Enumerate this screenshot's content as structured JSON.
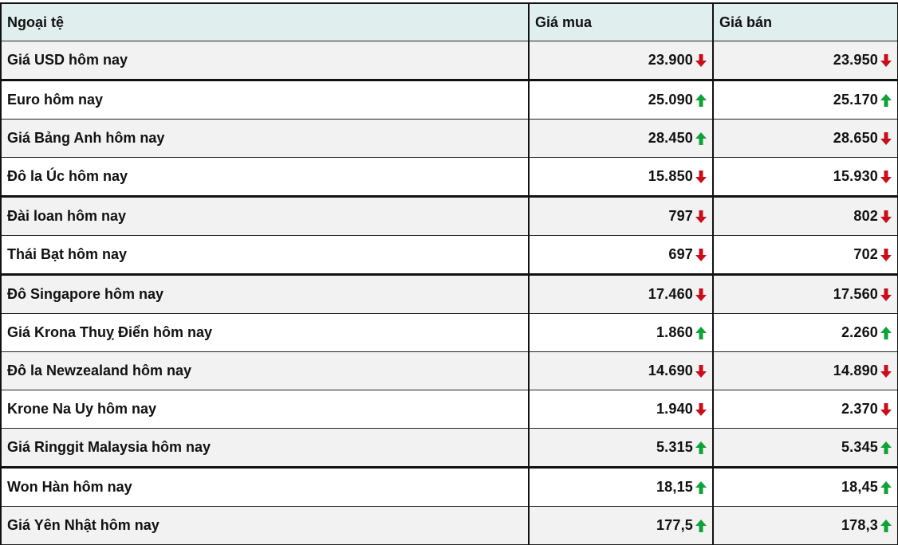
{
  "table": {
    "headers": [
      "Ngoại tệ",
      "Giá mua",
      "Giá bán"
    ],
    "colors": {
      "up": "#12a03a",
      "down": "#c4101c",
      "header_bg": "#e0efee",
      "row_shade": "#f2f2f2"
    },
    "rows": [
      {
        "name": "Giá USD hôm nay",
        "buy": "23.900",
        "buy_trend": "down",
        "sell": "23.950",
        "sell_trend": "down"
      },
      {
        "name": "Euro hôm nay",
        "buy": "25.090",
        "buy_trend": "up",
        "sell": "25.170",
        "sell_trend": "up"
      },
      {
        "name": "Giá Bảng Anh hôm nay",
        "buy": "28.450",
        "buy_trend": "up",
        "sell": "28.650",
        "sell_trend": "down"
      },
      {
        "name": "Đô la Úc hôm nay",
        "buy": "15.850",
        "buy_trend": "down",
        "sell": "15.930",
        "sell_trend": "down"
      },
      {
        "name": "Đài loan hôm nay",
        "buy": "797",
        "buy_trend": "down",
        "sell": "802",
        "sell_trend": "down"
      },
      {
        "name": "Thái Bạt hôm nay",
        "buy": "697",
        "buy_trend": "down",
        "sell": "702",
        "sell_trend": "down"
      },
      {
        "name": "Đô Singapore hôm nay",
        "buy": "17.460",
        "buy_trend": "down",
        "sell": "17.560",
        "sell_trend": "down"
      },
      {
        "name": "Giá Krona Thuỵ Điển hôm nay",
        "buy": "1.860",
        "buy_trend": "up",
        "sell": "2.260",
        "sell_trend": "up"
      },
      {
        "name": "Đô la Newzealand hôm nay",
        "buy": "14.690",
        "buy_trend": "down",
        "sell": "14.890",
        "sell_trend": "down"
      },
      {
        "name": "Krone Na Uy hôm nay",
        "buy": "1.940",
        "buy_trend": "down",
        "sell": "2.370",
        "sell_trend": "down"
      },
      {
        "name": "Giá Ringgit Malaysia hôm nay",
        "buy": "5.315",
        "buy_trend": "up",
        "sell": "5.345",
        "sell_trend": "up"
      },
      {
        "name": "Won Hàn hôm nay",
        "buy": "18,15",
        "buy_trend": "up",
        "sell": "18,45",
        "sell_trend": "up"
      },
      {
        "name": "Giá Yên Nhật hôm nay",
        "buy": "177,5",
        "buy_trend": "up",
        "sell": "178,3",
        "sell_trend": "up"
      }
    ]
  }
}
